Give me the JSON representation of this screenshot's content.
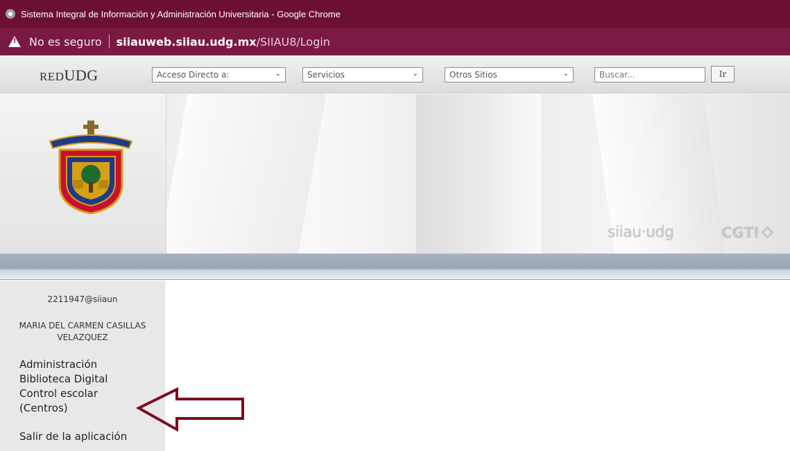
{
  "window": {
    "title": "Sistema Integral de Información y Administración Universitaria - Google Chrome"
  },
  "address_bar": {
    "security_label": "No es seguro",
    "host": "siiauweb.siiau.udg.mx",
    "path": "/SIIAU8/Login"
  },
  "top_nav": {
    "logo_red": "RED",
    "logo_udg": "UDG",
    "dropdowns": [
      {
        "label": "Acceso Directo a:"
      },
      {
        "label": "Servicios"
      },
      {
        "label": "Otros Sitios"
      }
    ],
    "search_placeholder": "Buscar...",
    "go_label": "Ir"
  },
  "banner": {
    "siiau_brand": "siiau·udg",
    "cgti_brand": "CGTI"
  },
  "sidebar": {
    "user_id": "2211947@siiaun",
    "user_name_line1": "MARIA DEL CARMEN CASILLAS",
    "user_name_line2": "VELAZQUEZ",
    "menu": [
      {
        "label": "Administración"
      },
      {
        "label": "Biblioteca Digital"
      },
      {
        "label": "Control escolar"
      },
      {
        "label": "(Centros)"
      }
    ],
    "logout_label": "Salir de la aplicación"
  },
  "colors": {
    "titlebar": "#6b0f33",
    "addressbar": "#7a1a42",
    "annotation_arrow": "#7a0c1e"
  }
}
